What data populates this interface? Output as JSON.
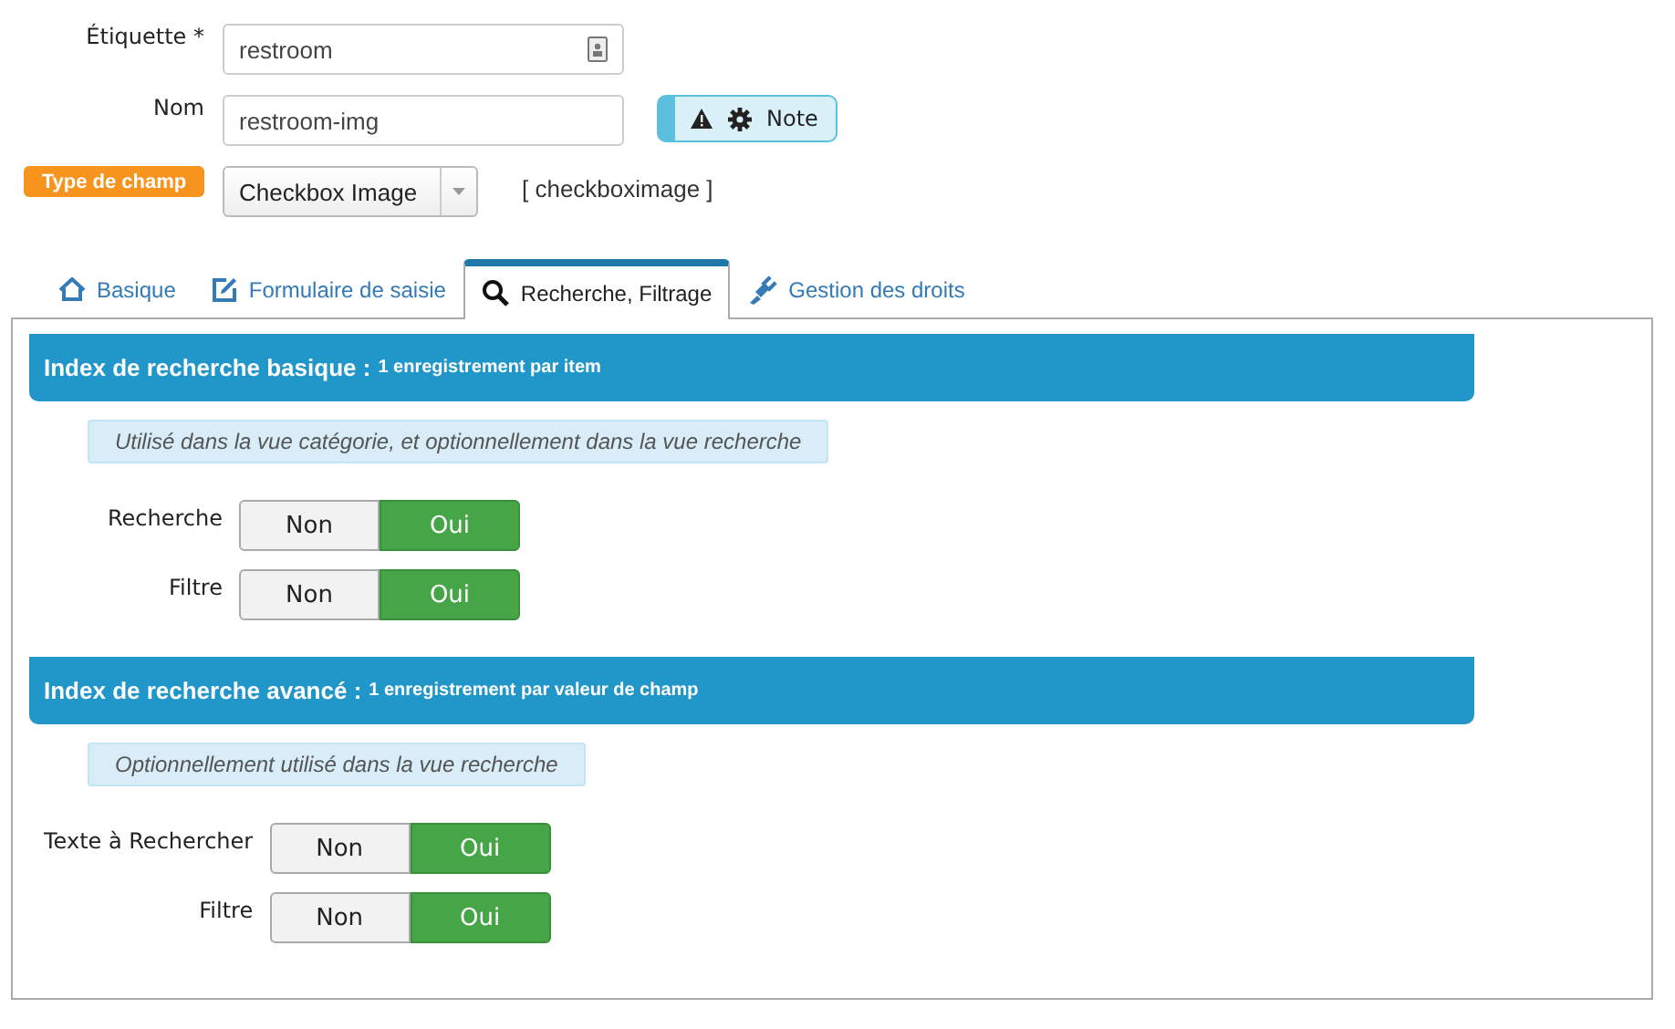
{
  "fields": [
    {
      "label": "Étiquette *",
      "value": "restroom"
    },
    {
      "label": "Nom",
      "value": "restroom-img"
    }
  ],
  "note_button": {
    "label": "Note"
  },
  "type_field": {
    "badge": "Type de champ",
    "value": "Checkbox Image",
    "code": "[ checkboximage ]"
  },
  "tabs": [
    {
      "label": "Basique",
      "selected": false
    },
    {
      "label": "Formulaire de saisie",
      "selected": false
    },
    {
      "label": "Recherche, Filtrage",
      "selected": true
    },
    {
      "label": "Gestion des droits",
      "selected": false
    }
  ],
  "sections": [
    {
      "title": "Index de recherche basique :",
      "subtitle": "1 enregistrement par item",
      "note": "Utilisé dans la vue catégorie, et optionnellement dans la vue recherche",
      "toggles": [
        {
          "label": "Recherche",
          "options": [
            {
              "label": "Non",
              "selected": false
            },
            {
              "label": "Oui",
              "selected": true
            }
          ]
        },
        {
          "label": "Filtre",
          "options": [
            {
              "label": "Non",
              "selected": false
            },
            {
              "label": "Oui",
              "selected": true
            }
          ]
        }
      ]
    },
    {
      "title": "Index de recherche avancé :",
      "subtitle": "1 enregistrement par valeur de champ",
      "note": "Optionnellement utilisé dans la vue recherche",
      "toggles": [
        {
          "label": "Texte à Rechercher",
          "options": [
            {
              "label": "Non",
              "selected": false
            },
            {
              "label": "Oui",
              "selected": true
            }
          ]
        },
        {
          "label": "Filtre",
          "options": [
            {
              "label": "Non",
              "selected": false
            },
            {
              "label": "Oui",
              "selected": true
            }
          ]
        }
      ]
    }
  ]
}
